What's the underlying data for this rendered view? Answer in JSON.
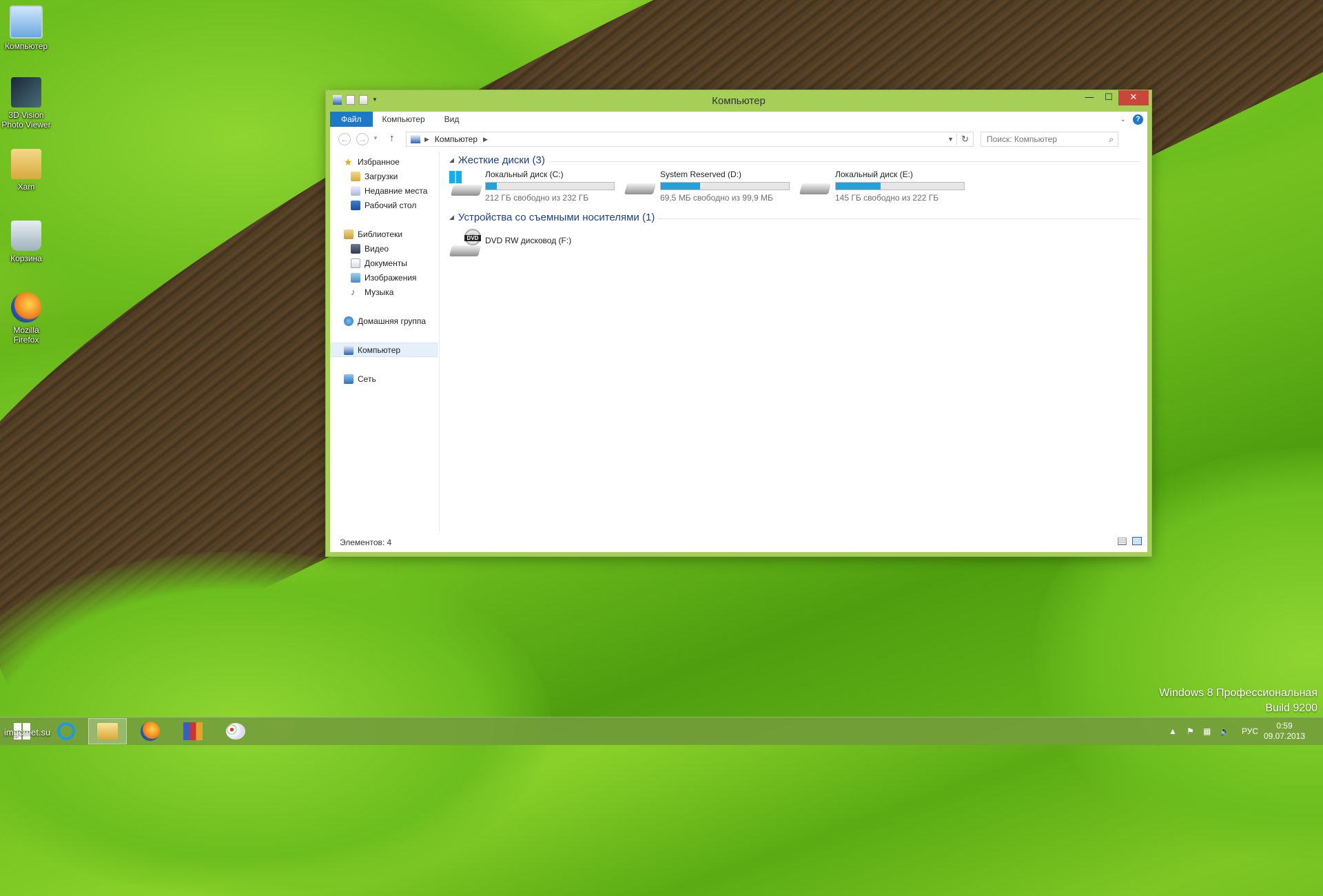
{
  "desktop": {
    "icons": [
      {
        "label": "Компьютер"
      },
      {
        "label": "3D Vision\nPhoto Viewer"
      },
      {
        "label": "Xam"
      },
      {
        "label": "Корзина"
      },
      {
        "label": "Mozilla\nFirefox"
      }
    ],
    "watermark": {
      "line1": "Windows 8 Профессиональная",
      "line2": "Build 9200"
    }
  },
  "window": {
    "title": "Компьютер",
    "controls": {
      "minimize": "—",
      "maximize": "☐",
      "close": "✕"
    },
    "ribbon": {
      "tabs": [
        "Файл",
        "Компьютер",
        "Вид"
      ],
      "help": "?"
    },
    "address": {
      "location": "Компьютер",
      "search_placeholder": "Поиск: Компьютер"
    },
    "nav": {
      "favorites": "Избранное",
      "downloads": "Загрузки",
      "recent": "Недавние места",
      "desktop": "Рабочий стол",
      "libraries": "Библиотеки",
      "video": "Видео",
      "documents": "Документы",
      "images": "Изображения",
      "music": "Музыка",
      "homegroup": "Домашняя группа",
      "computer": "Компьютер",
      "network": "Сеть"
    },
    "groups": {
      "hard_drives": "Жесткие диски (3)",
      "removable": "Устройства со съемными носителями (1)"
    },
    "drives": [
      {
        "name": "Локальный диск (C:)",
        "free": "212 ГБ свободно из 232 ГБ",
        "used_fraction": 0.086
      },
      {
        "name": "System Reserved (D:)",
        "free": "69,5 МБ свободно из 99,9 МБ",
        "used_fraction": 0.304
      },
      {
        "name": "Локальный диск (E:)",
        "free": "145 ГБ свободно из 222 ГБ",
        "used_fraction": 0.347
      }
    ],
    "removable_drive": {
      "name": "DVD RW дисковод (F:)",
      "badge": "DVD"
    },
    "status": {
      "items": "Элементов: 4"
    }
  },
  "taskbar": {
    "overlay_text": "imgcrnet.su",
    "tray": {
      "lang": "РУС",
      "time": "0:59",
      "date": "09.07.2013"
    }
  },
  "colors": {
    "accent": "#1e78c8",
    "window_frame": "#a6cf57",
    "progress": "#26a0da",
    "close": "#c9463d"
  }
}
